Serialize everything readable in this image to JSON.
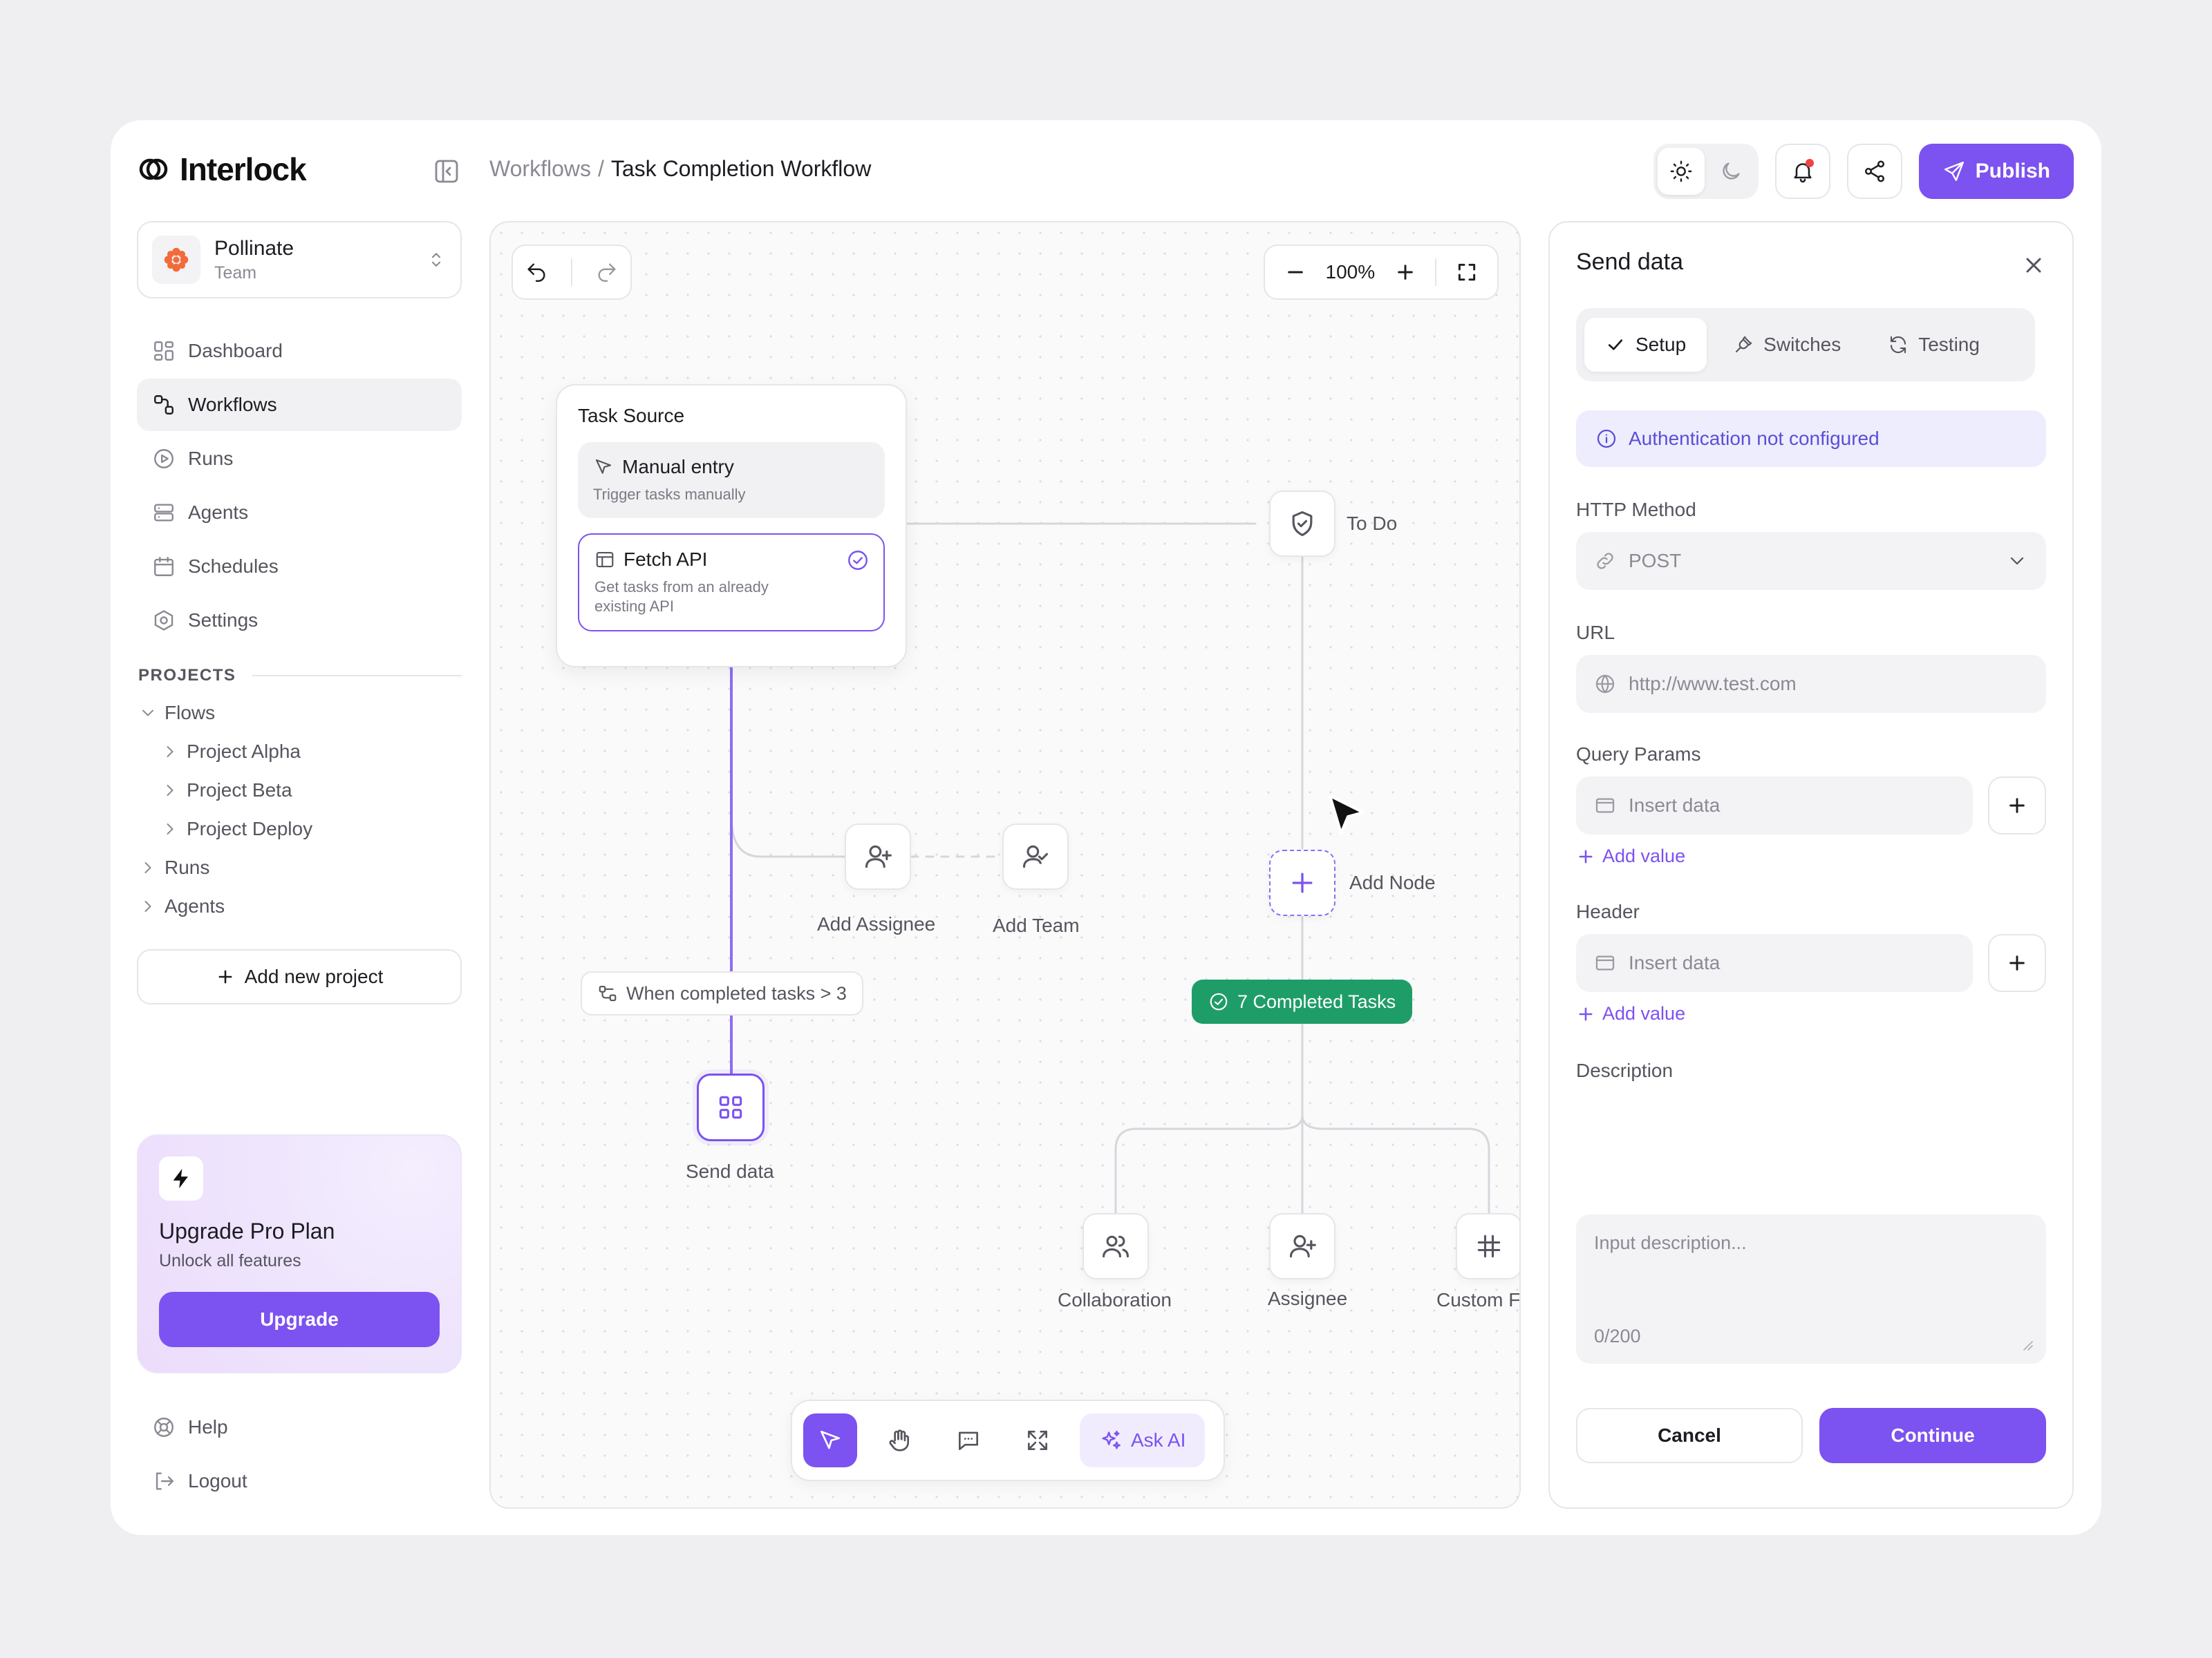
{
  "app": {
    "brand": "Interlock",
    "breadcrumb": {
      "parent": "Workflows",
      "separator": "/",
      "current": "Task Completion Workflow"
    },
    "publish_label": "Publish"
  },
  "team": {
    "name": "Pollinate",
    "type": "Team"
  },
  "nav": {
    "dashboard": "Dashboard",
    "workflows": "Workflows",
    "runs": "Runs",
    "agents": "Agents",
    "schedules": "Schedules",
    "settings": "Settings"
  },
  "projects": {
    "title": "PROJECTS",
    "flows": "Flows",
    "alpha": "Project Alpha",
    "beta": "Project Beta",
    "deploy": "Project Deploy",
    "runs": "Runs",
    "agents": "Agents",
    "add_label": "Add new project"
  },
  "upgrade": {
    "title": "Upgrade Pro Plan",
    "subtitle": "Unlock all features",
    "button": "Upgrade"
  },
  "bottom_nav": {
    "help": "Help",
    "logout": "Logout"
  },
  "canvas": {
    "zoom": "100%",
    "task_source": {
      "title": "Task Source",
      "manual_title": "Manual entry",
      "manual_desc": "Trigger tasks manually",
      "fetch_title": "Fetch API",
      "fetch_desc": "Get tasks from an already existing API"
    },
    "nodes": {
      "todo": "To Do",
      "add_node": "Add Node",
      "add_assignee": "Add Assignee",
      "add_team": "Add Team",
      "send_data": "Send data",
      "collaboration": "Collaboration",
      "assignee": "Assignee",
      "custom_field": "Custom Fi"
    },
    "condition": "When completed tasks > 3",
    "completed": "7 Completed Tasks",
    "ask_ai": "Ask AI"
  },
  "panel": {
    "title": "Send data",
    "tabs": {
      "setup": "Setup",
      "switches": "Switches",
      "testing": "Testing"
    },
    "alert": "Authentication not configured",
    "http_method_label": "HTTP Method",
    "http_method_value": "POST",
    "url_label": "URL",
    "url_placeholder": "http://www.test.com",
    "query_label": "Query Params",
    "query_placeholder": "Insert data",
    "header_label": "Header",
    "header_placeholder": "Insert data",
    "add_value": "Add value",
    "description_label": "Description",
    "description_placeholder": "Input description...",
    "description_count": "0/200",
    "cancel": "Cancel",
    "continue": "Continue"
  },
  "colors": {
    "accent": "#7c52f0",
    "success": "#1f9d68",
    "info": "#5b4fd6"
  }
}
